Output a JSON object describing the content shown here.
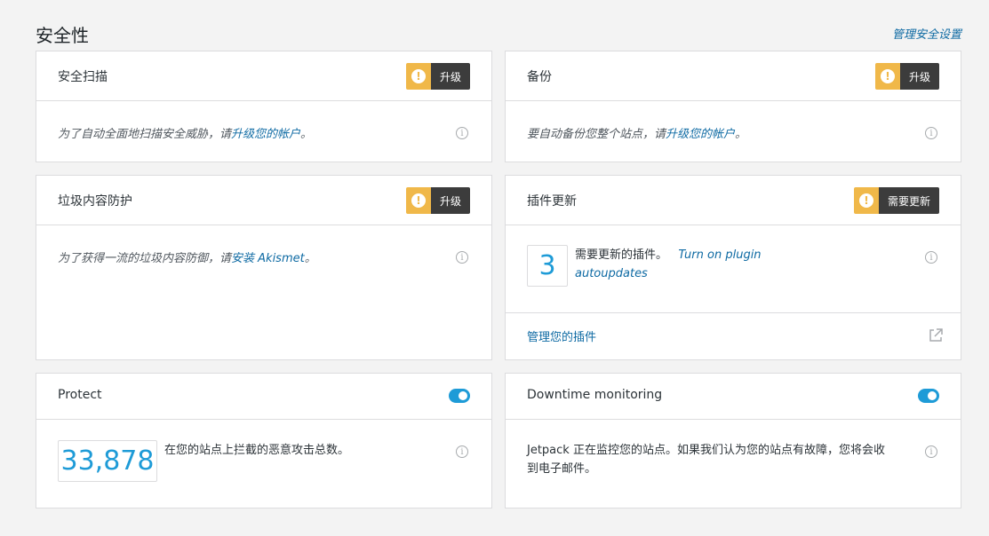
{
  "header": {
    "title": "安全性",
    "manage_link": "管理安全设置"
  },
  "cards": {
    "scan": {
      "title": "安全扫描",
      "badge": "升级",
      "text_prefix": "为了自动全面地扫描安全威胁，请",
      "text_link": "升级您的帐户",
      "text_suffix": "。"
    },
    "backup": {
      "title": "备份",
      "badge": "升级",
      "text_prefix": "要自动备份您整个站点，请",
      "text_link": "升级您的帐户",
      "text_suffix": "。"
    },
    "spam": {
      "title": "垃圾内容防护",
      "badge": "升级",
      "text_prefix": "为了获得一流的垃圾内容防御，请",
      "text_link": "安装 Akismet",
      "text_suffix": "。"
    },
    "plugins": {
      "title": "插件更新",
      "badge": "需要更新",
      "count": "3",
      "count_label": "需要更新的插件。",
      "autoupdate_link_1": "Turn on plugin",
      "autoupdate_link_2": "autoupdates",
      "manage_link": "管理您的插件"
    },
    "protect": {
      "title": "Protect",
      "enabled": true,
      "count": "33,878",
      "count_label": "在您的站点上拦截的恶意攻击总数。"
    },
    "downtime": {
      "title": "Downtime monitoring",
      "enabled": true,
      "text_line1": "Jetpack 正在监控您的站点。如果我们认为您的站点有故障，您将会收",
      "text_line2": "到电子邮件。"
    }
  },
  "icons": {
    "warning": "!",
    "info": "i"
  },
  "colors": {
    "accent": "#1e9bd7",
    "link": "#0e6aa3",
    "warning": "#f0b849",
    "badge_dark": "#3c3c3c"
  }
}
